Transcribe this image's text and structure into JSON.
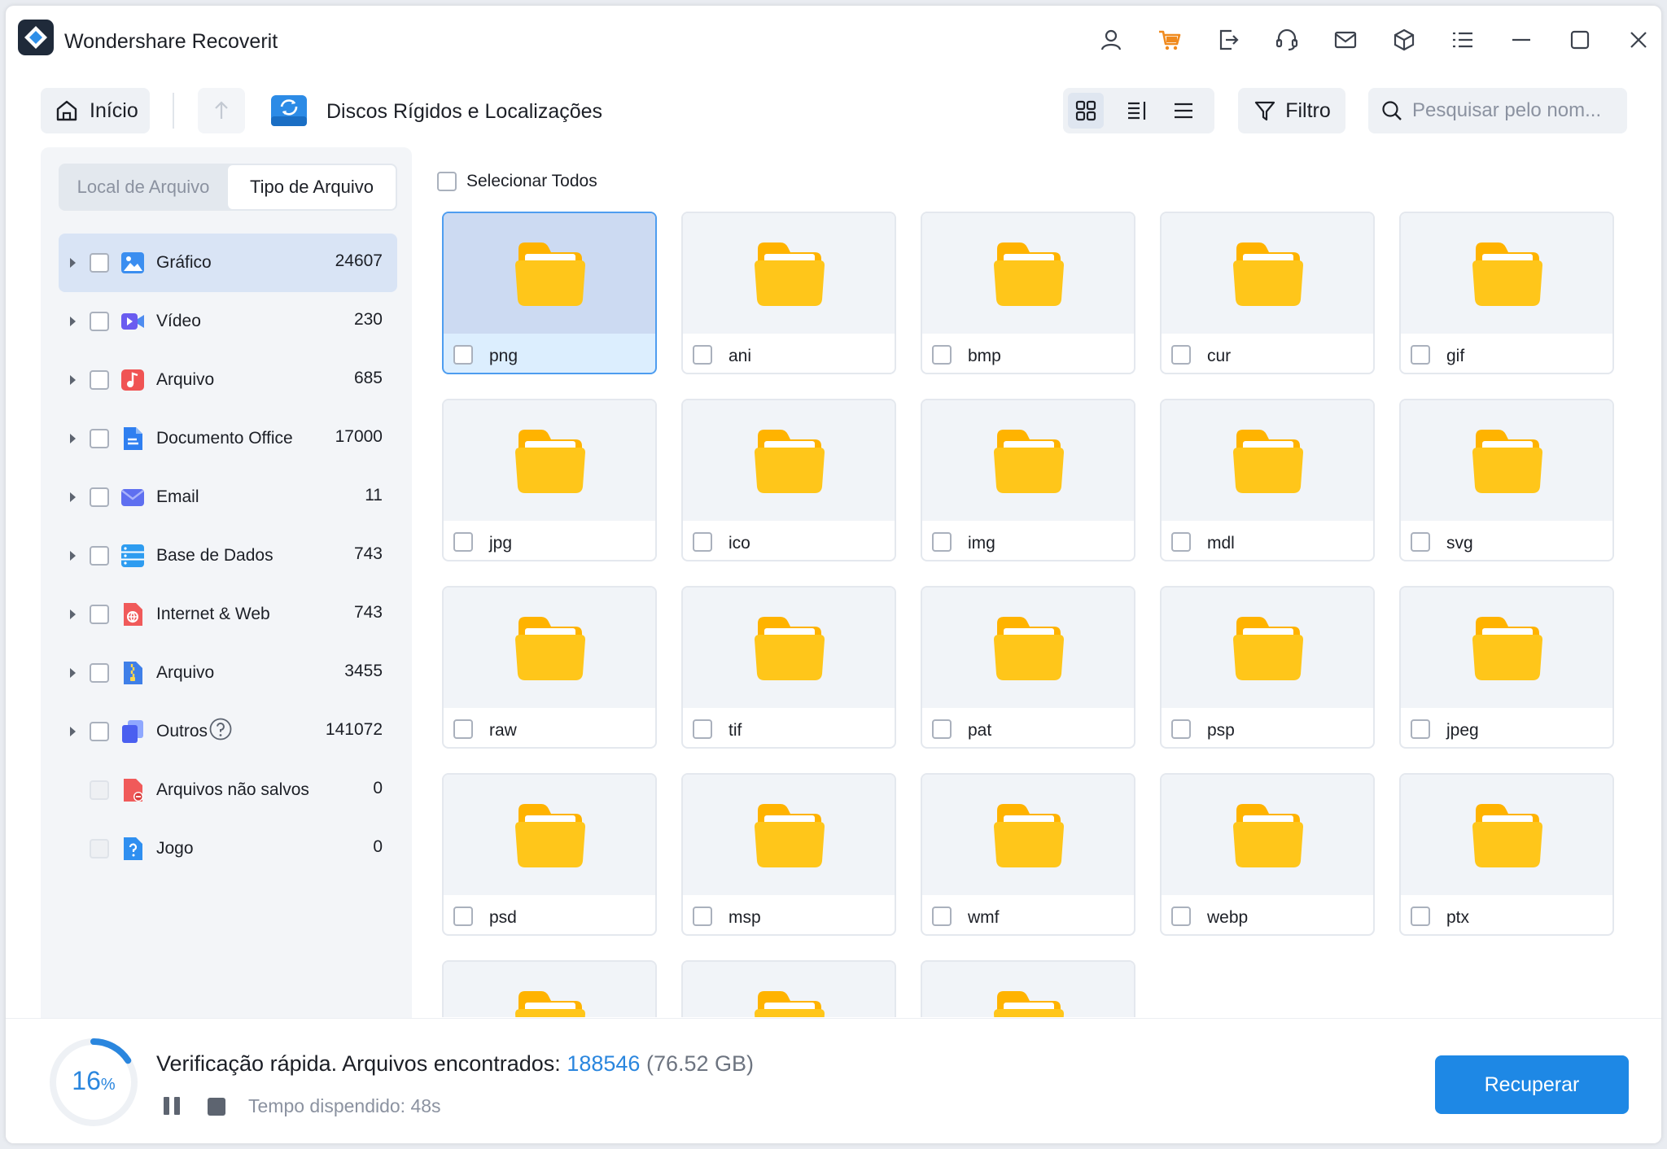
{
  "app": {
    "title": "Wondershare Recoverit"
  },
  "titlebar_icons": [
    "user-icon",
    "cart-icon",
    "export-icon",
    "headset-icon",
    "mail-icon",
    "cube-icon",
    "menu-list-icon",
    "minimize-icon",
    "maximize-icon",
    "close-icon"
  ],
  "colors": {
    "accent": "#1e88e5",
    "cart": "#f08a1e",
    "folder": "#ffb300",
    "selected_tile": "#dceefe"
  },
  "toolbar": {
    "home_label": "Início",
    "location_title": "Discos Rígidos e Localizações",
    "filter_label": "Filtro",
    "search_placeholder": "Pesquisar pelo nom..."
  },
  "sidebar": {
    "tabs": {
      "file_location": "Local de Arquivo",
      "file_type": "Tipo de Arquivo"
    },
    "active_tab": "Tipo de Arquivo",
    "categories": [
      {
        "label": "Gráfico",
        "count": "24607",
        "icon": "image-icon",
        "selected": true
      },
      {
        "label": "Vídeo",
        "count": "230",
        "icon": "video-icon"
      },
      {
        "label": "Arquivo",
        "count": "685",
        "icon": "audio-icon"
      },
      {
        "label": "Documento Office",
        "count": "17000",
        "icon": "document-icon"
      },
      {
        "label": "Email",
        "count": "11",
        "icon": "email-icon"
      },
      {
        "label": "Base de Dados",
        "count": "743",
        "icon": "database-icon"
      },
      {
        "label": "Internet & Web",
        "count": "743",
        "icon": "web-icon"
      },
      {
        "label": "Arquivo",
        "count": "3455",
        "icon": "archive-icon"
      },
      {
        "label": "Outros",
        "count": "141072",
        "icon": "others-icon"
      },
      {
        "label": "Arquivos não salvos",
        "count": "0",
        "icon": "unsaved-icon"
      },
      {
        "label": "Jogo",
        "count": "0",
        "icon": "game-icon"
      }
    ]
  },
  "main": {
    "select_all_label": "Selecionar Todos",
    "tiles": [
      "png",
      "ani",
      "bmp",
      "cur",
      "gif",
      "jpg",
      "ico",
      "img",
      "mdl",
      "svg",
      "raw",
      "tif",
      "pat",
      "psp",
      "jpeg",
      "psd",
      "msp",
      "wmf",
      "webp",
      "ptx",
      "",
      "",
      ""
    ],
    "selected_tile": "png"
  },
  "footer": {
    "progress_percent": 16,
    "percent_number": "16",
    "percent_sign": "%",
    "status_prefix": "Verificação rápida. Arquivos encontrados:",
    "files_found": "188546",
    "total_size": "(76.52 GB)",
    "elapsed": "Tempo dispendido: 48s",
    "recover_label": "Recuperar"
  }
}
